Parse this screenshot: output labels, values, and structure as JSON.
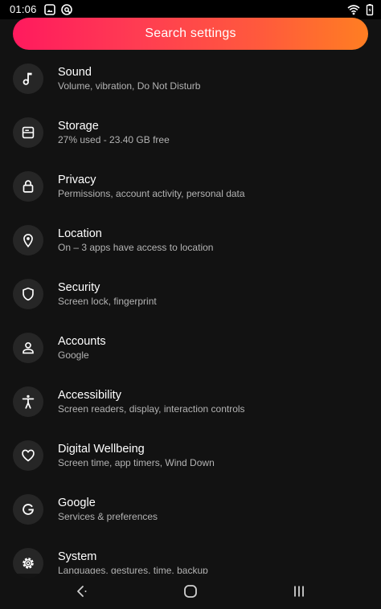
{
  "status_bar": {
    "time": "01:06",
    "left_icons": [
      "gallery-notification-icon",
      "vpn-key-icon"
    ],
    "right_icons": [
      "wifi-icon",
      "battery-icon"
    ]
  },
  "search": {
    "label": "Search settings",
    "gradient_start": "#ff1a5e",
    "gradient_end": "#ff7e22"
  },
  "settings": {
    "items": [
      {
        "title": "Sound",
        "summary": "Volume, vibration, Do Not Disturb",
        "icon": "music-note-icon"
      },
      {
        "title": "Storage",
        "summary": "27% used - 23.40 GB free",
        "icon": "storage-icon"
      },
      {
        "title": "Privacy",
        "summary": "Permissions, account activity, personal data",
        "icon": "lock-icon"
      },
      {
        "title": "Location",
        "summary": "On – 3 apps have access to location",
        "icon": "location-pin-icon"
      },
      {
        "title": "Security",
        "summary": "Screen lock, fingerprint",
        "icon": "shield-icon"
      },
      {
        "title": "Accounts",
        "summary": "Google",
        "icon": "account-icon"
      },
      {
        "title": "Accessibility",
        "summary": "Screen readers, display, interaction controls",
        "icon": "accessibility-icon"
      },
      {
        "title": "Digital Wellbeing",
        "summary": "Screen time, app timers, Wind Down",
        "icon": "heart-icon"
      },
      {
        "title": "Google",
        "summary": "Services & preferences",
        "icon": "google-g-icon"
      },
      {
        "title": "System",
        "summary": "Languages, gestures, time, backup",
        "icon": "system-gear-icon"
      }
    ]
  },
  "nav_bar": {
    "buttons": [
      "back-icon",
      "home-icon",
      "recents-icon"
    ]
  }
}
